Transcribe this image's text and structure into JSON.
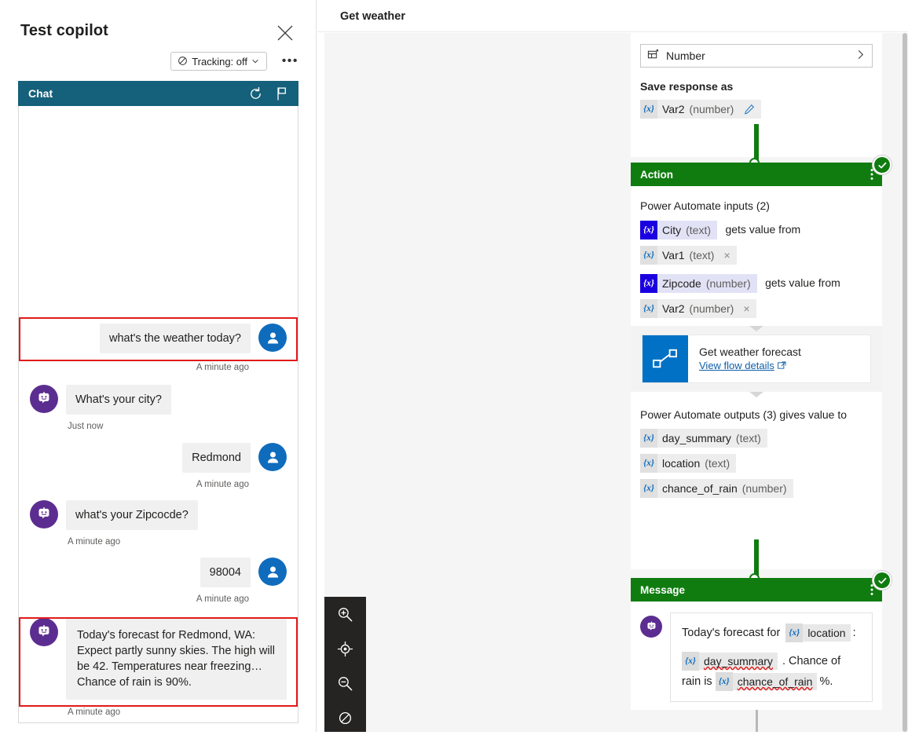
{
  "test_panel": {
    "title": "Test copilot",
    "close_label": "×",
    "tracking_label": "Tracking: off",
    "more_label": "•••",
    "chat": {
      "bar_title": "Chat",
      "restart_icon": "restart-icon",
      "flag_icon": "flag-icon"
    },
    "messages": [
      {
        "from": "user",
        "text": "what's the weather today?",
        "time": "A minute ago",
        "highlighted": true
      },
      {
        "from": "bot",
        "text": "What's your city?",
        "time": "Just now",
        "highlighted": false
      },
      {
        "from": "user",
        "text": "Redmond",
        "time": "A minute ago",
        "highlighted": false
      },
      {
        "from": "bot",
        "text": "what's your Zipcocde?",
        "time": "A minute ago",
        "highlighted": false
      },
      {
        "from": "user",
        "text": "98004",
        "time": "A minute ago",
        "highlighted": false
      },
      {
        "from": "bot",
        "text": "Today's forecast for Redmond, WA: Expect partly sunny skies. The high will be 42. Temperatures near freezing… Chance of rain is 90%.",
        "time": "A minute ago",
        "highlighted": true
      }
    ]
  },
  "canvas": {
    "title": "Get weather",
    "question_node": {
      "identify_field": "Number",
      "save_label": "Save response as",
      "variable": {
        "name": "Var2",
        "type": "(number)",
        "token": "{x}",
        "edit_icon": "pencil-icon"
      }
    },
    "action_node": {
      "header": "Action",
      "inputs_label": "Power Automate inputs (2)",
      "inputs": [
        {
          "param": {
            "name": "City",
            "type": "(text)",
            "token": "{x}"
          },
          "connector_text": "gets value from",
          "value": {
            "name": "Var1",
            "type": "(text)",
            "token": "{x}",
            "remove": "×"
          }
        },
        {
          "param": {
            "name": "Zipcode",
            "type": "(number)",
            "token": "{x}"
          },
          "connector_text": "gets value from",
          "value": {
            "name": "Var2",
            "type": "(number)",
            "token": "{x}",
            "remove": "×"
          }
        }
      ],
      "flow": {
        "name": "Get weather forecast",
        "link": "View flow details",
        "link_icon": "external-link-icon",
        "icon": "power-automate-icon"
      },
      "outputs_label": "Power Automate outputs (3) gives value to",
      "outputs": [
        {
          "name": "day_summary",
          "type": "(text)",
          "token": "{x}"
        },
        {
          "name": "location",
          "type": "(text)",
          "token": "{x}"
        },
        {
          "name": "chance_of_rain",
          "type": "(number)",
          "token": "{x}"
        }
      ]
    },
    "message_node": {
      "header": "Message",
      "avatar": "bot-avatar",
      "line1_pre": "Today's forecast for",
      "line1_var": "location",
      "line1_post": ":",
      "line2_var": "day_summary",
      "line2_mid": ". Chance of rain is",
      "line3_var": "chance_of_rain",
      "line3_post": "%.",
      "token": "{x}"
    },
    "zoom_toolbar": [
      {
        "name": "zoom-in-icon"
      },
      {
        "name": "fit-to-screen-icon"
      },
      {
        "name": "zoom-out-icon"
      },
      {
        "name": "reset-zoom-icon"
      }
    ],
    "colors": {
      "node_header_green": "#107c10",
      "chat_bar_teal": "#15607a",
      "user_avatar_blue": "#0f6cbd",
      "bot_avatar_purple": "#5c2d91",
      "flow_icon_blue": "#0071c5",
      "highlight_red": "#e01b1b",
      "param_pill_blue": "#1a00e0"
    }
  }
}
